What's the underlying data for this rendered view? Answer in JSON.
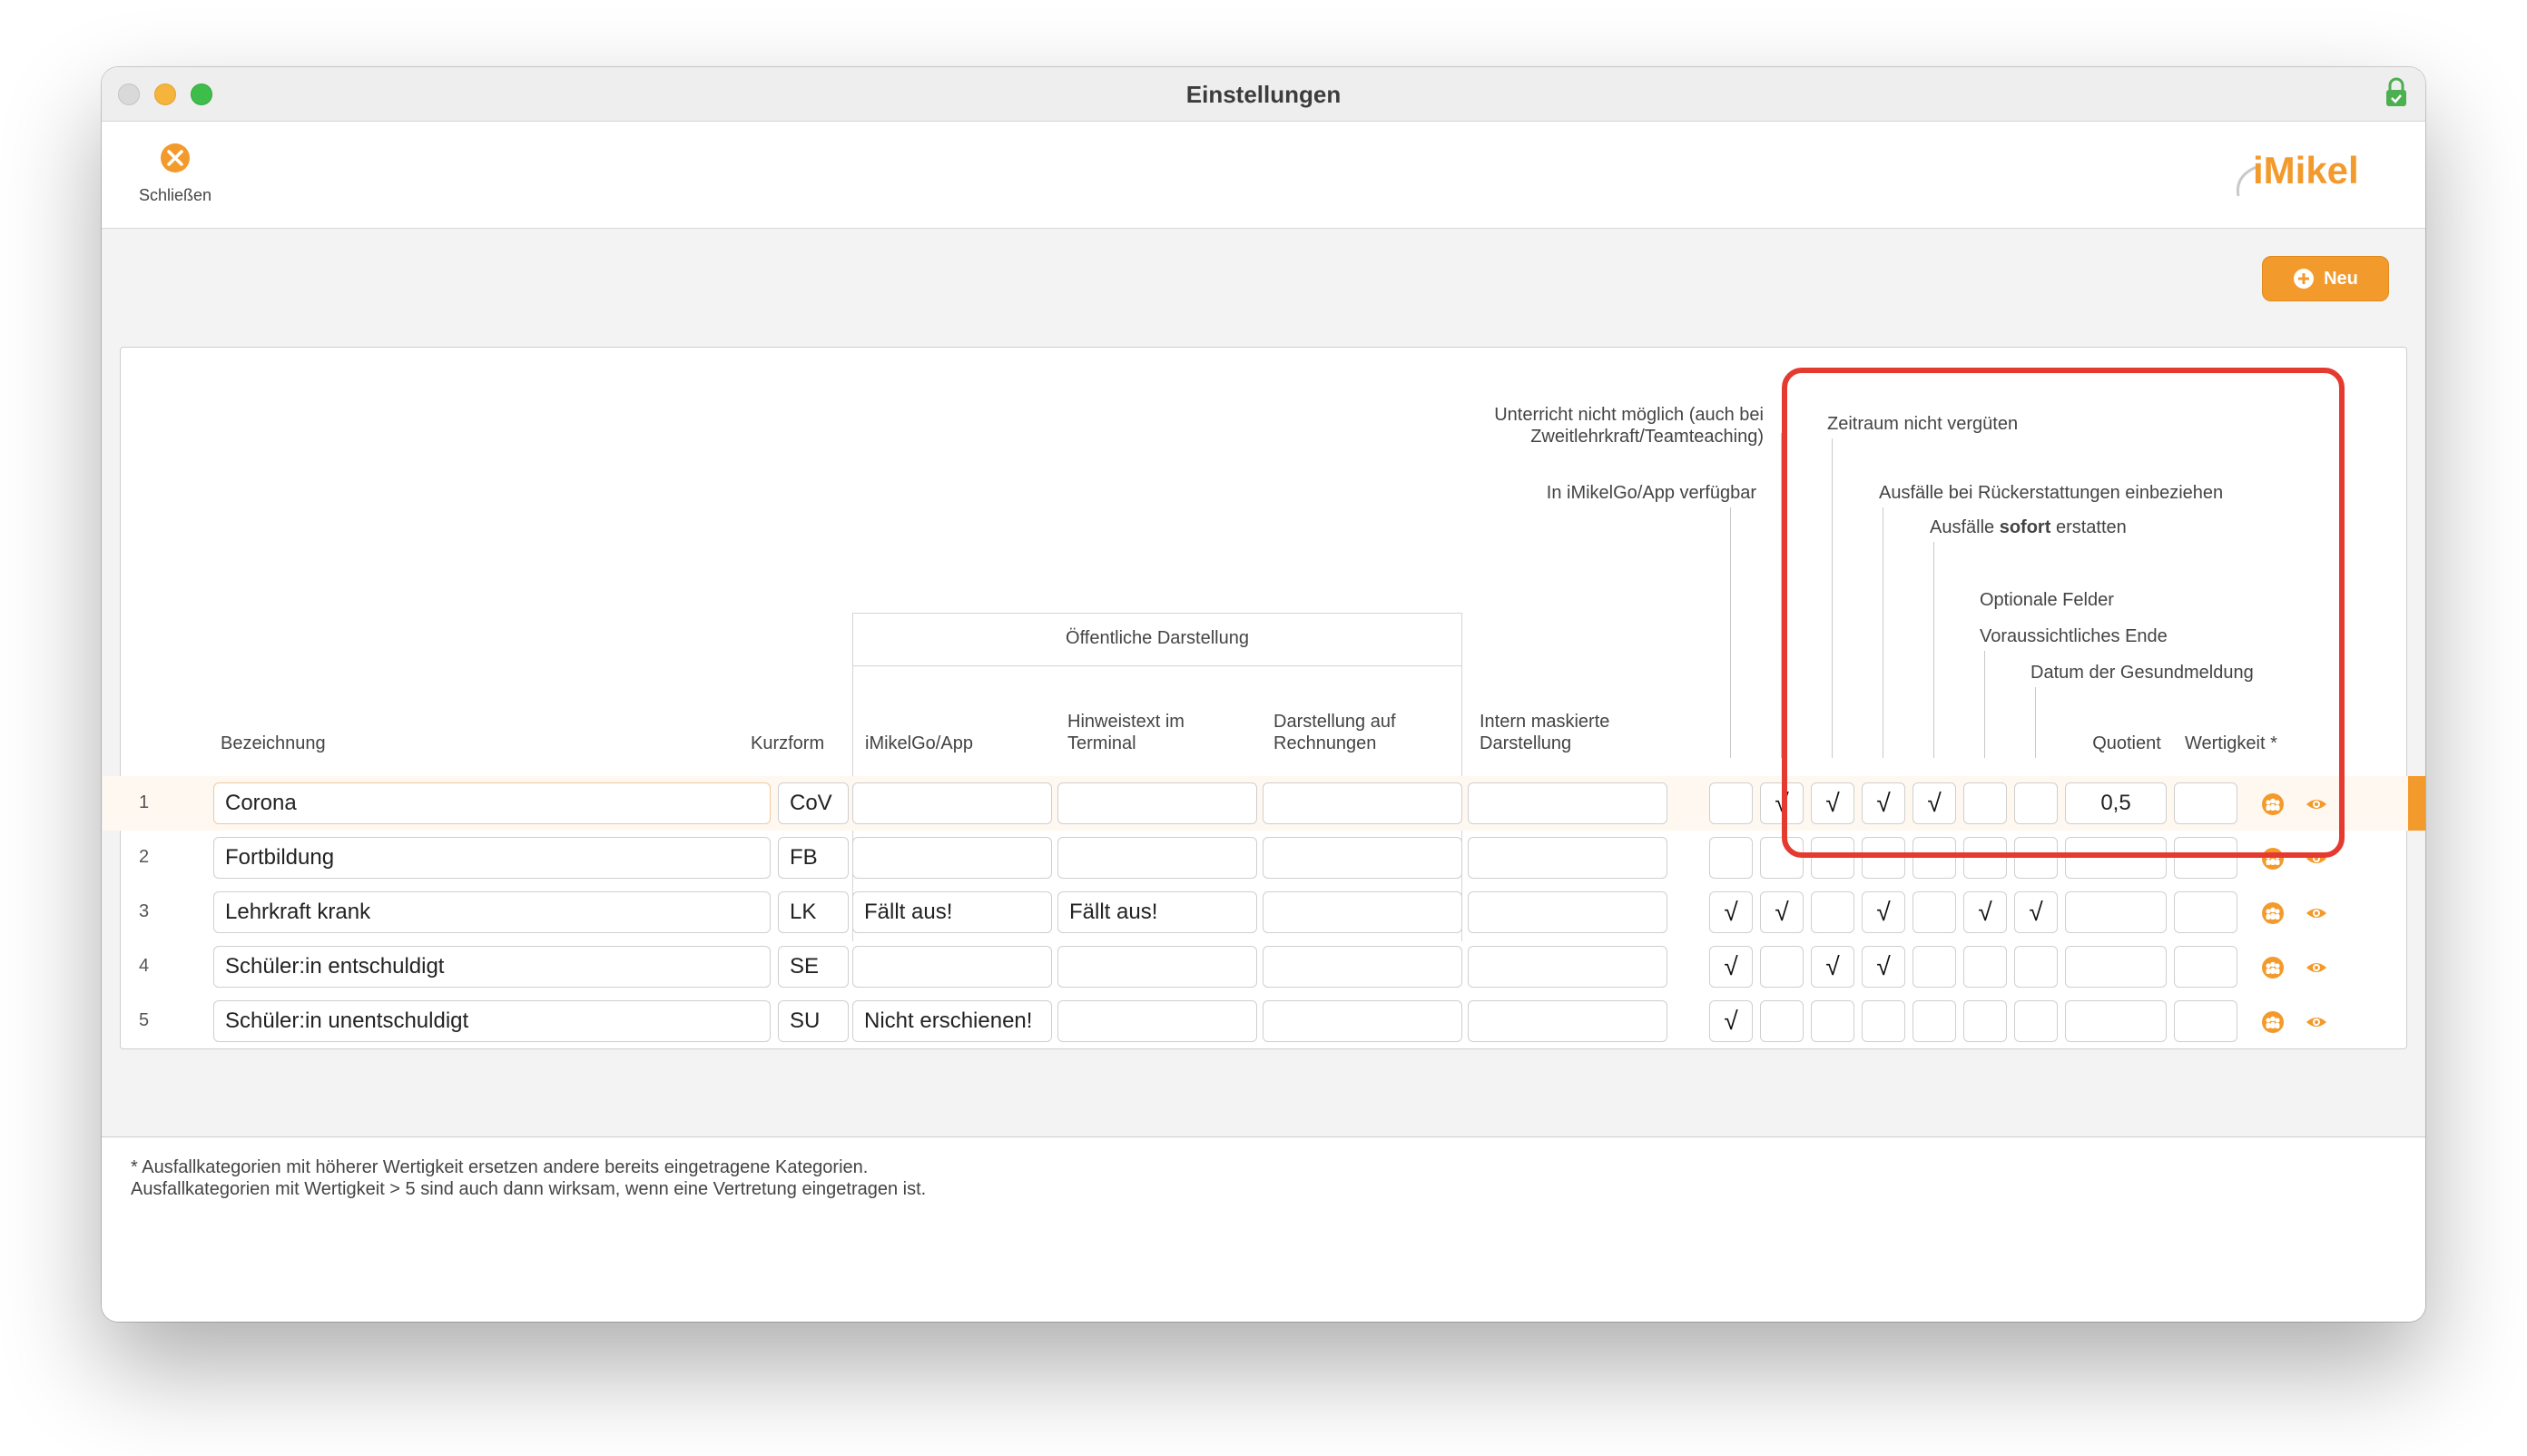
{
  "window": {
    "title": "Einstellungen"
  },
  "colors": {
    "accent": "#f39a2c",
    "highlight": "#e53a2f",
    "lock": "#4caf50"
  },
  "toolbar": {
    "close_label": "Schließen",
    "close_icon": "close-circle-icon",
    "logo": "iMikel"
  },
  "actions": {
    "new_label": "Neu",
    "new_icon": "plus-circle-icon"
  },
  "headers": {
    "bezeichnung": "Bezeichnung",
    "kurzform": "Kurzform",
    "public_group": "Öffentliche Darstellung",
    "imikelgo_app": "iMikelGo/App",
    "hinweistext_1": "Hinweistext im",
    "hinweistext_2": "Terminal",
    "rechnungen_1": "Darstellung auf",
    "rechnungen_2": "Rechnungen",
    "intern_1": "Intern maskierte",
    "intern_2": "Darstellung",
    "unterricht_1": "Unterricht nicht möglich (auch bei",
    "unterricht_2": "Zweitlehrkraft/Teamteaching)",
    "app_verfuegbar": "In iMikelGo/App verfügbar",
    "zeitraum": "Zeitraum nicht vergüten",
    "rueckerstattung": "Ausfälle bei Rückerstattungen einbeziehen",
    "sofort_pre": "Ausfälle ",
    "sofort_bold": "sofort",
    "sofort_post": " erstatten",
    "optionale": "Optionale Felder",
    "ende": "Voraussichtliches Ende",
    "gesundmeldung": "Datum der Gesundmeldung",
    "quotient": "Quotient",
    "wertigkeit": "Wertigkeit *"
  },
  "rows": [
    {
      "num": "1",
      "name": "Corona",
      "kurz": "CoV",
      "app": "",
      "hinweis": "",
      "rechnung": "",
      "intern": "",
      "checks": [
        "",
        "√",
        "√",
        "√",
        "√",
        "",
        ""
      ],
      "quotient": "0,5",
      "wertigkeit": "",
      "selected": true
    },
    {
      "num": "2",
      "name": "Fortbildung",
      "kurz": "FB",
      "app": "",
      "hinweis": "",
      "rechnung": "",
      "intern": "",
      "checks": [
        "",
        "",
        "",
        "",
        "",
        "",
        ""
      ],
      "quotient": "",
      "wertigkeit": ""
    },
    {
      "num": "3",
      "name": "Lehrkraft krank",
      "kurz": "LK",
      "app": "Fällt aus!",
      "hinweis": "Fällt aus!",
      "rechnung": "",
      "intern": "",
      "checks": [
        "√",
        "√",
        "",
        "√",
        "",
        "√",
        "√"
      ],
      "quotient": "",
      "wertigkeit": ""
    },
    {
      "num": "4",
      "name": "Schüler:in entschuldigt",
      "kurz": "SE",
      "app": "",
      "hinweis": "",
      "rechnung": "",
      "intern": "",
      "checks": [
        "√",
        "",
        "√",
        "√",
        "",
        "",
        ""
      ],
      "quotient": "",
      "wertigkeit": ""
    },
    {
      "num": "5",
      "name": "Schüler:in unentschuldigt",
      "kurz": "SU",
      "app": "Nicht erschienen!",
      "hinweis": "",
      "rechnung": "",
      "intern": "",
      "checks": [
        "√",
        "",
        "",
        "",
        "",
        "",
        ""
      ],
      "quotient": "",
      "wertigkeit": ""
    }
  ],
  "footer": {
    "line1": "* Ausfallkategorien mit höherer Wertigkeit ersetzen andere bereits eingetragene Kategorien.",
    "line2": "Ausfallkategorien mit Wertigkeit > 5 sind auch dann wirksam, wenn eine Vertretung eingetragen ist."
  }
}
